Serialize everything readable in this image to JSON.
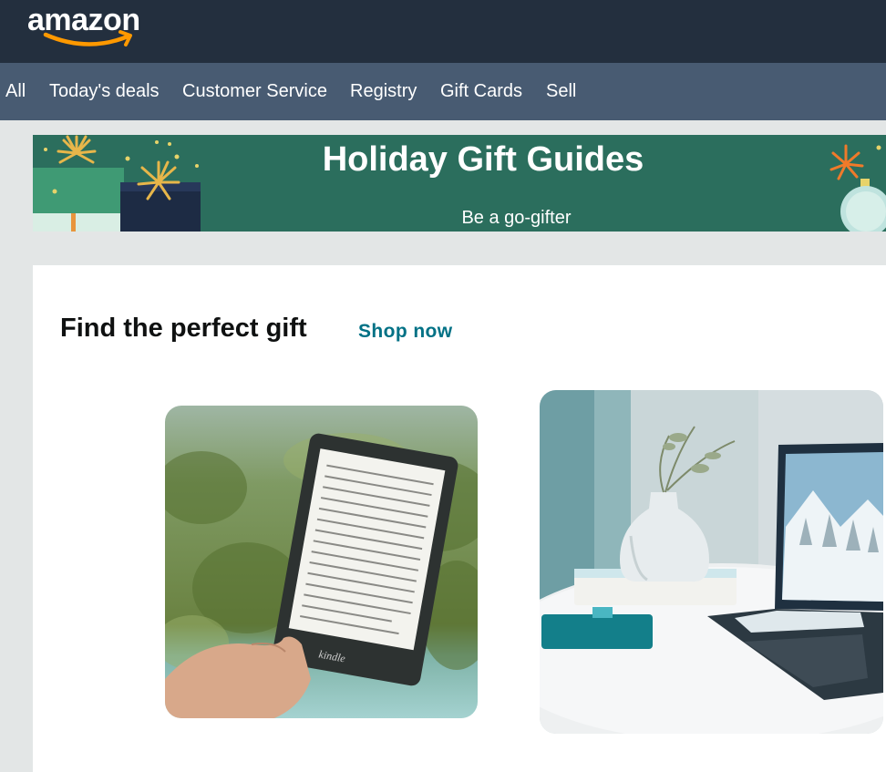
{
  "header": {
    "logo_text": "amazon",
    "logo_icon": "amazon-smile-logo",
    "background": "#232f3e"
  },
  "nav": {
    "background": "#485b72",
    "items": [
      {
        "label": "All"
      },
      {
        "label": "Today's deals"
      },
      {
        "label": "Customer Service"
      },
      {
        "label": "Registry"
      },
      {
        "label": "Gift Cards"
      },
      {
        "label": "Sell"
      }
    ]
  },
  "banner": {
    "title": "Holiday Gift Guides",
    "subtitle": "Be a go-gifter",
    "background": "#2b6e5d"
  },
  "gift_section": {
    "title": "Find the perfect gift",
    "link": "Shop now",
    "link_color": "#007185",
    "tiles": [
      {
        "name": "kindle-ereader-image",
        "brand_text": "kindle"
      },
      {
        "name": "laptop-decor-image"
      }
    ]
  },
  "colors": {
    "page_background": "#e3e6e6",
    "logo_smile": "#f90"
  }
}
